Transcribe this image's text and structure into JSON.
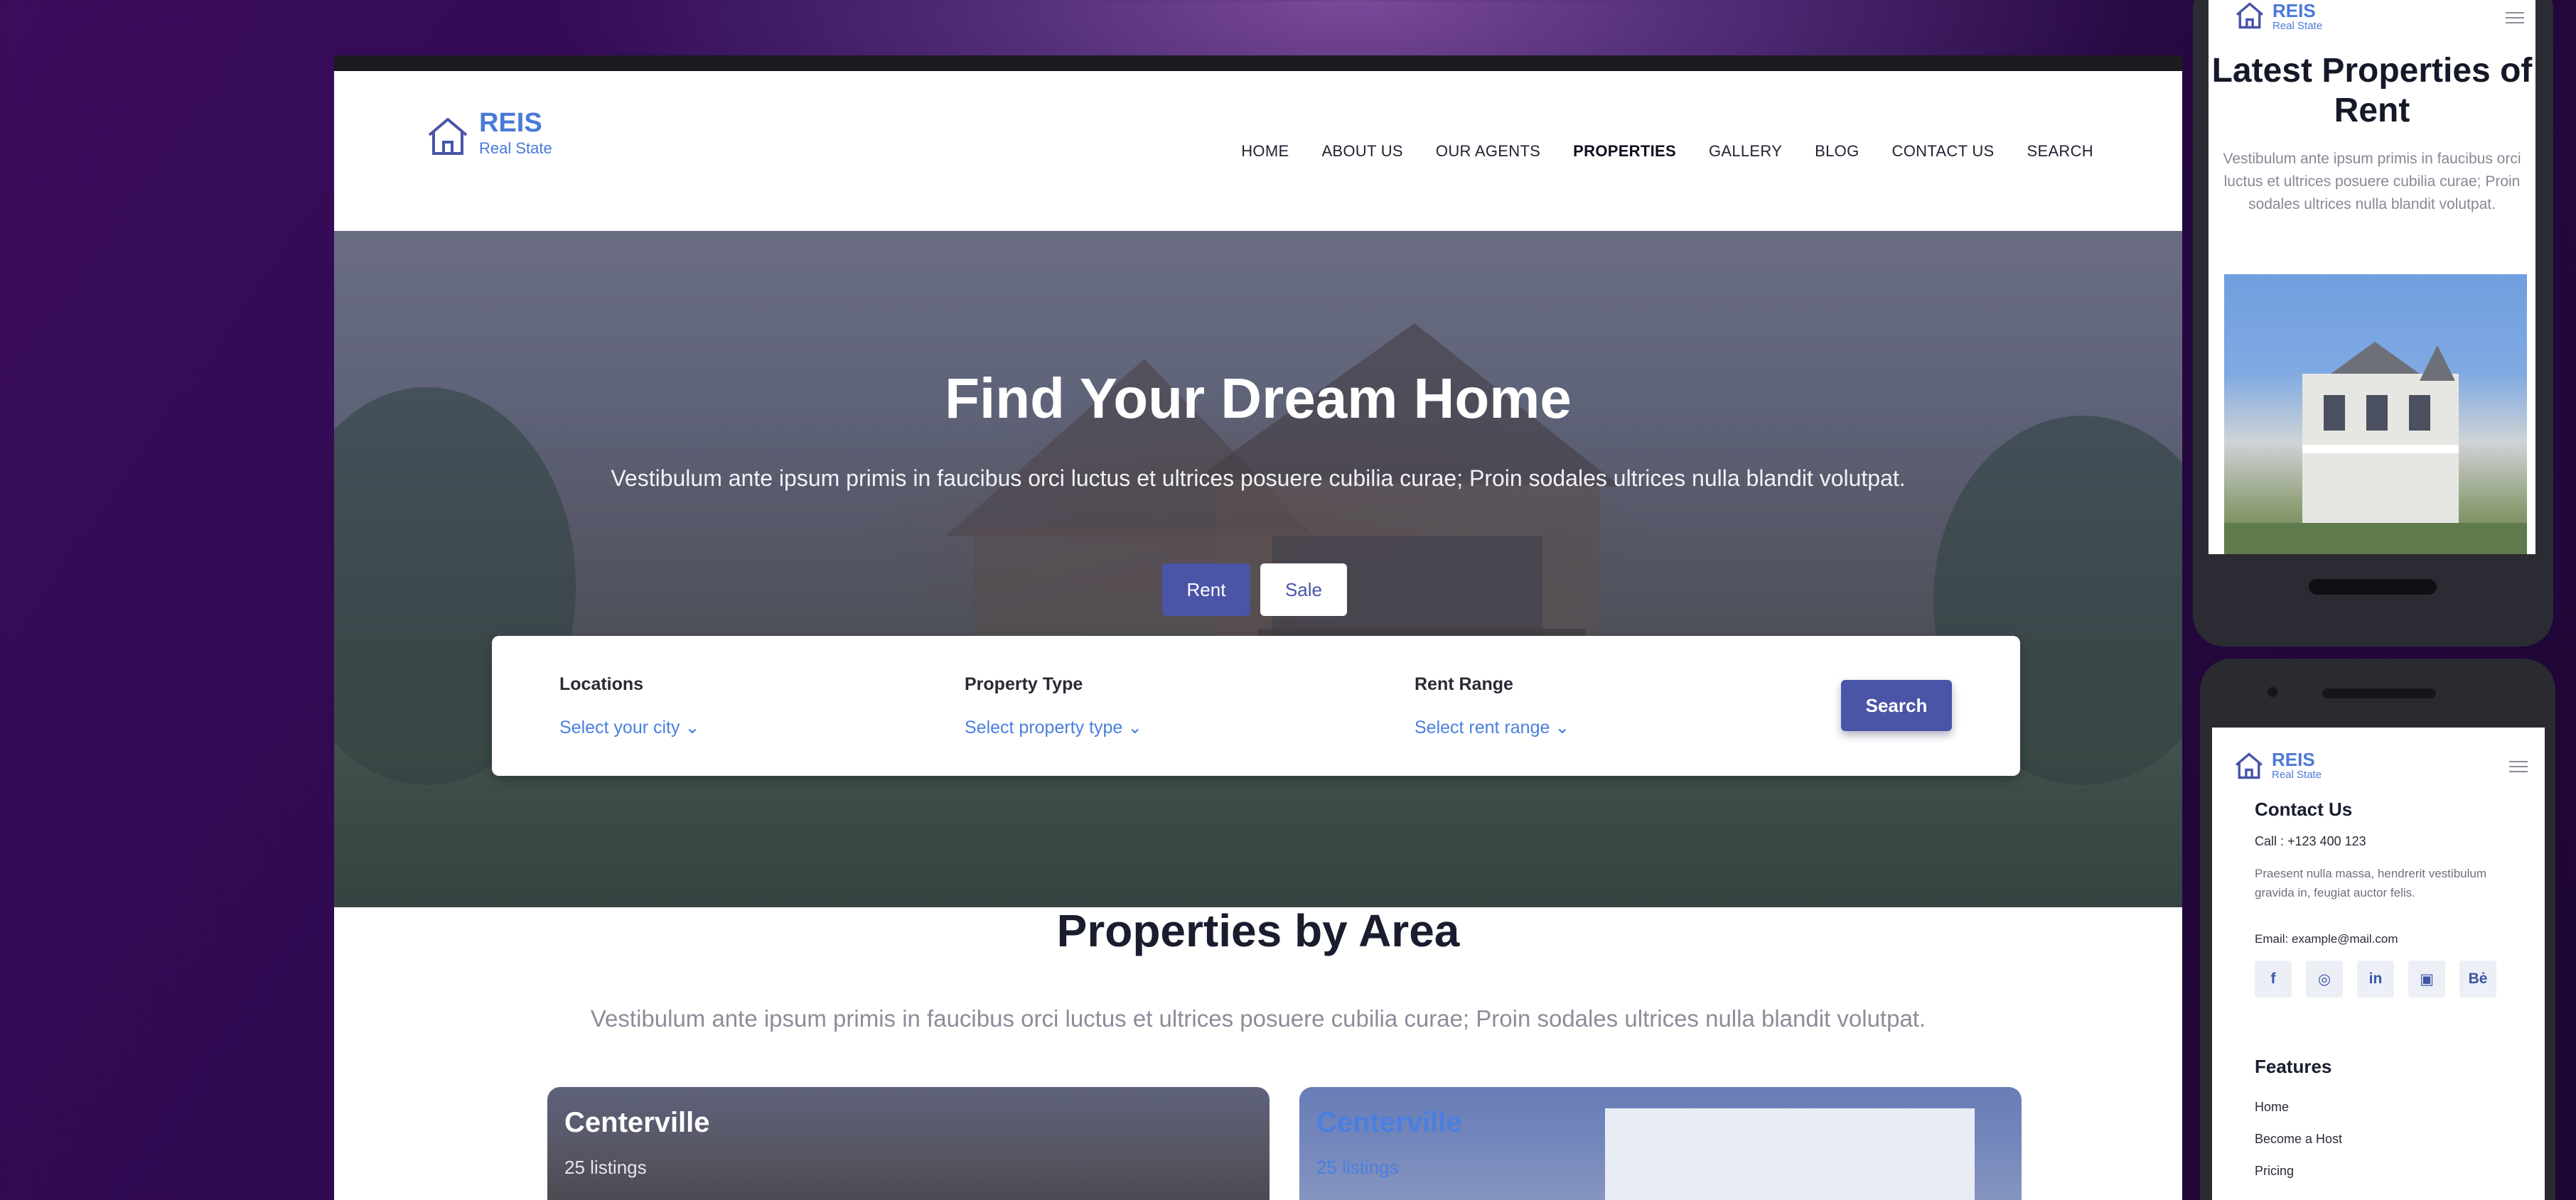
{
  "brand": {
    "name": "REIS",
    "tagline": "Real State"
  },
  "colors": {
    "accent": "#4a55a8",
    "link": "#4a7fe0",
    "background": "#2e0a4f"
  },
  "desktop": {
    "nav": [
      "HOME",
      "ABOUT US",
      "OUR AGENTS",
      "PROPERTIES",
      "GALLERY",
      "BLOG",
      "CONTACT US",
      "SEARCH"
    ],
    "nav_active": "PROPERTIES",
    "hero": {
      "title": "Find Your Dream Home",
      "subtitle": "Vestibulum ante ipsum primis in faucibus orci luctus et ultrices posuere cubilia curae; Proin sodales ultrices nulla blandit volutpat.",
      "tabs": [
        "Rent",
        "Sale"
      ],
      "selected_tab": "Rent"
    },
    "search": {
      "fields": [
        {
          "label": "Locations",
          "value": "Select your city ⌄"
        },
        {
          "label": "Property Type",
          "value": "Select property type ⌄"
        },
        {
          "label": "Rent Range",
          "value": "Select rent range ⌄"
        }
      ],
      "button": "Search"
    },
    "area_section": {
      "title": "Properties by Area",
      "subtitle": "Vestibulum ante ipsum primis in faucibus orci luctus et ultrices posuere cubilia curae; Proin sodales ultrices nulla blandit volutpat.",
      "cards": [
        {
          "name": "Centerville",
          "count": "25 listings"
        },
        {
          "name": "Centerville",
          "count": "25 listings"
        }
      ]
    }
  },
  "mobile_top": {
    "title": "Latest Properties of Rent",
    "subtitle": "Vestibulum ante ipsum primis in faucibus orci luctus et ultrices posuere cubilia curae; Proin sodales ultrices nulla blandit volutpat."
  },
  "mobile_bottom": {
    "contact_heading": "Contact Us",
    "call": "Call : +123 400 123",
    "text": "Praesent nulla massa, hendrerit vestibulum gravida in, feugiat auctor felis.",
    "email": "Email: example@mail.com",
    "social": [
      {
        "icon": "facebook-icon",
        "glyph": "f"
      },
      {
        "icon": "dribbble-icon",
        "glyph": "◎"
      },
      {
        "icon": "linkedin-icon",
        "glyph": "in"
      },
      {
        "icon": "instagram-icon",
        "glyph": "▣"
      },
      {
        "icon": "behance-icon",
        "glyph": "Bė"
      }
    ],
    "features_heading": "Features",
    "features": [
      "Home",
      "Become a Host",
      "Pricing"
    ]
  }
}
